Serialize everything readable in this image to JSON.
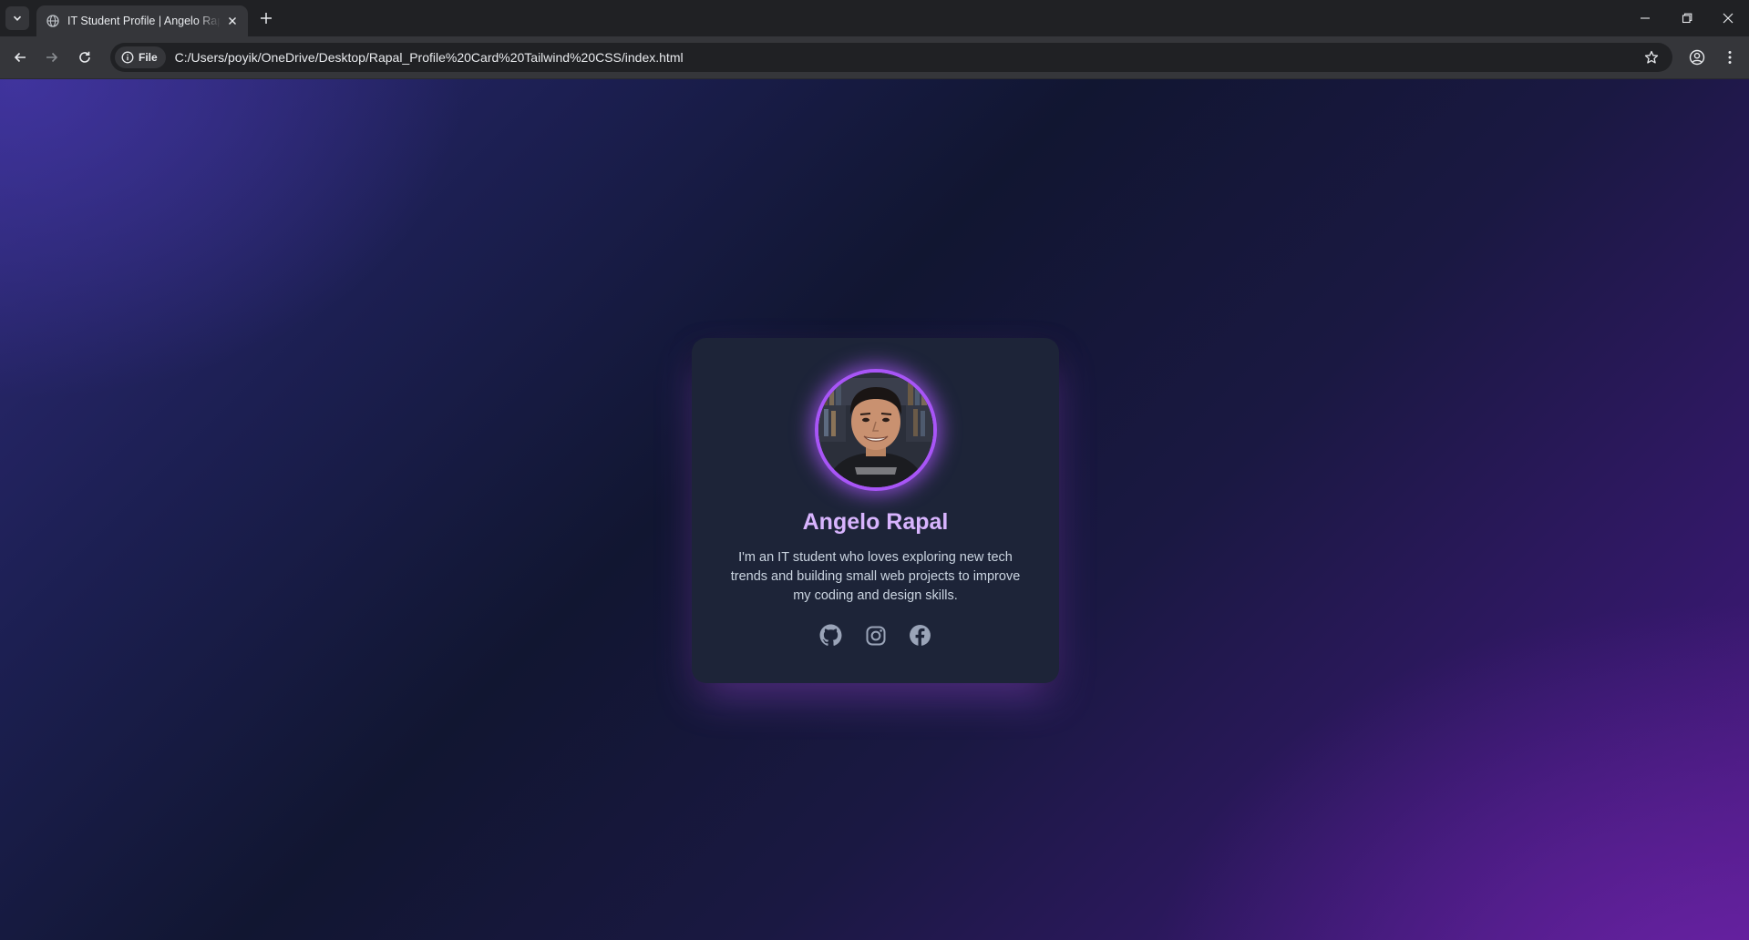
{
  "browser": {
    "tab": {
      "title": "IT Student Profile | Angelo Rapal",
      "close_icon": "close-icon",
      "favicon": "globe-icon"
    },
    "new_tab_icon": "plus-icon",
    "tab_search_icon": "chevron-down-icon",
    "window_controls": [
      "minimize-icon",
      "restore-icon",
      "close-icon"
    ],
    "toolbar": {
      "back_icon": "arrow-left-icon",
      "forward_icon": "arrow-right-icon",
      "reload_icon": "reload-icon",
      "site_chip_label": "File",
      "url": "C:/Users/poyik/OneDrive/Desktop/Rapal_Profile%20Card%20Tailwind%20CSS/index.html",
      "bookmark_icon": "star-icon",
      "profile_icon": "account-icon",
      "menu_icon": "kebab-menu-icon"
    }
  },
  "page": {
    "profile_card": {
      "name": "Angelo Rapal",
      "bio": "I'm an IT student who loves exploring new tech trends and building small web projects to improve my coding and design skills.",
      "social_icons": [
        "github-icon",
        "instagram-icon",
        "facebook-icon"
      ]
    },
    "colors": {
      "accent": "#a855f7",
      "name_text": "#d8b4fe",
      "card_bg": "#1d2438",
      "bio_text": "#cbd5e1",
      "icon": "#9aa4b8"
    }
  }
}
